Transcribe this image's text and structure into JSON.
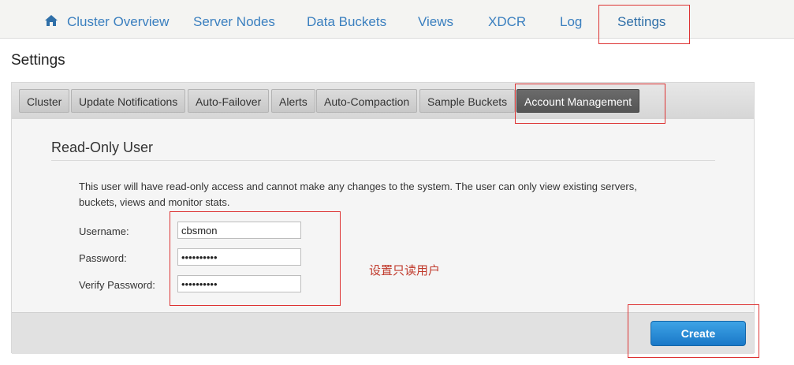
{
  "topnav": {
    "items": [
      {
        "label": "Cluster Overview"
      },
      {
        "label": "Server Nodes"
      },
      {
        "label": "Data Buckets"
      },
      {
        "label": "Views"
      },
      {
        "label": "XDCR"
      },
      {
        "label": "Log"
      },
      {
        "label": "Settings"
      }
    ],
    "active": "Settings"
  },
  "page": {
    "title": "Settings"
  },
  "tabs": {
    "items": [
      {
        "label": "Cluster"
      },
      {
        "label": "Update Notifications"
      },
      {
        "label": "Auto-Failover"
      },
      {
        "label": "Alerts"
      },
      {
        "label": "Auto-Compaction"
      },
      {
        "label": "Sample Buckets"
      },
      {
        "label": "Account Management"
      }
    ],
    "active": "Account Management"
  },
  "section": {
    "title": "Read-Only User",
    "description": "This user will have read-only access and cannot make any changes to the system. The user can only view existing servers, buckets, views and monitor stats."
  },
  "form": {
    "username_label": "Username:",
    "username_value": "cbsmon",
    "password_label": "Password:",
    "password_value": "••••••••••",
    "verify_label": "Verify Password:",
    "verify_value": "••••••••••"
  },
  "annotation": "设置只读用户",
  "actions": {
    "create_label": "Create"
  },
  "colors": {
    "link": "#3a7fbf",
    "annotation": "#c0392b",
    "button": "#1a78c8"
  },
  "icons": {
    "home": "home-icon"
  }
}
